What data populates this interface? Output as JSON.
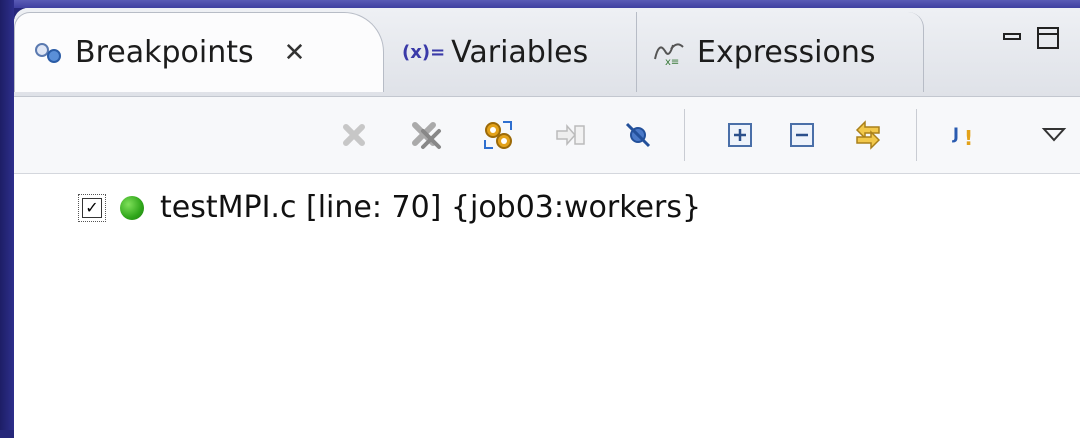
{
  "tabs": [
    {
      "label": "Breakpoints",
      "active": true,
      "icon": "breakpoints-icon"
    },
    {
      "label": "Variables",
      "icon_text": "(x)=",
      "icon": "variables-icon"
    },
    {
      "label": "Expressions",
      "icon": "expressions-icon"
    }
  ],
  "toolbar": {
    "buttons": [
      "remove-icon",
      "remove-all-icon",
      "skip-all-icon",
      "go-to-file-icon",
      "skip-breakpoints-icon",
      "expand-all-icon",
      "collapse-all-icon",
      "link-with-debug-icon",
      "java-exception-icon",
      "view-menu-icon"
    ]
  },
  "breakpoints": [
    {
      "checked": true,
      "label": "testMPI.c [line: 70] {job03:workers}",
      "check_glyph": "✓"
    }
  ],
  "colors": {
    "frame": "#26277a",
    "enabled_dot": "#2fa61a"
  }
}
